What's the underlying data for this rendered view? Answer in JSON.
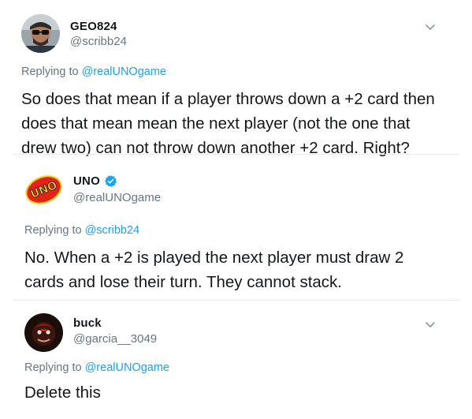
{
  "tweets": [
    {
      "display_name": "GEO824",
      "handle": "@scribb24",
      "replying_prefix": "Replying to ",
      "replying_to": "@realUNOgame",
      "text": "So does that mean if a player throws down a +2 card then\ndoes that mean mean the next player (not the one that\ndrew two) can not  throw down another +2 card. Right?",
      "avatar_icon": "user-photo-sunglasses",
      "has_menu": true
    },
    {
      "display_name": "UNO",
      "handle": "@realUNOgame",
      "verified": true,
      "verified_icon": "verified-badge-icon",
      "replying_prefix": "Replying to ",
      "replying_to": "@scribb24",
      "text": "No. When a +2 is played the next player must draw 2\ncards and lose their turn. They cannot stack.",
      "avatar_icon": "uno-logo",
      "avatar_logo_text": "UNO",
      "has_menu": false
    },
    {
      "display_name": "buck",
      "handle": "@garcia__3049",
      "replying_prefix": "Replying to ",
      "replying_to": "@realUNOgame",
      "text": "Delete this",
      "avatar_icon": "dark-character-avatar",
      "has_menu": true
    }
  ],
  "colors": {
    "text": "#14171a",
    "secondary": "#657786",
    "link": "#1da1f2",
    "verified": "#1da1f2",
    "uno_red": "#e2231a",
    "uno_yellow": "#f7d117"
  }
}
